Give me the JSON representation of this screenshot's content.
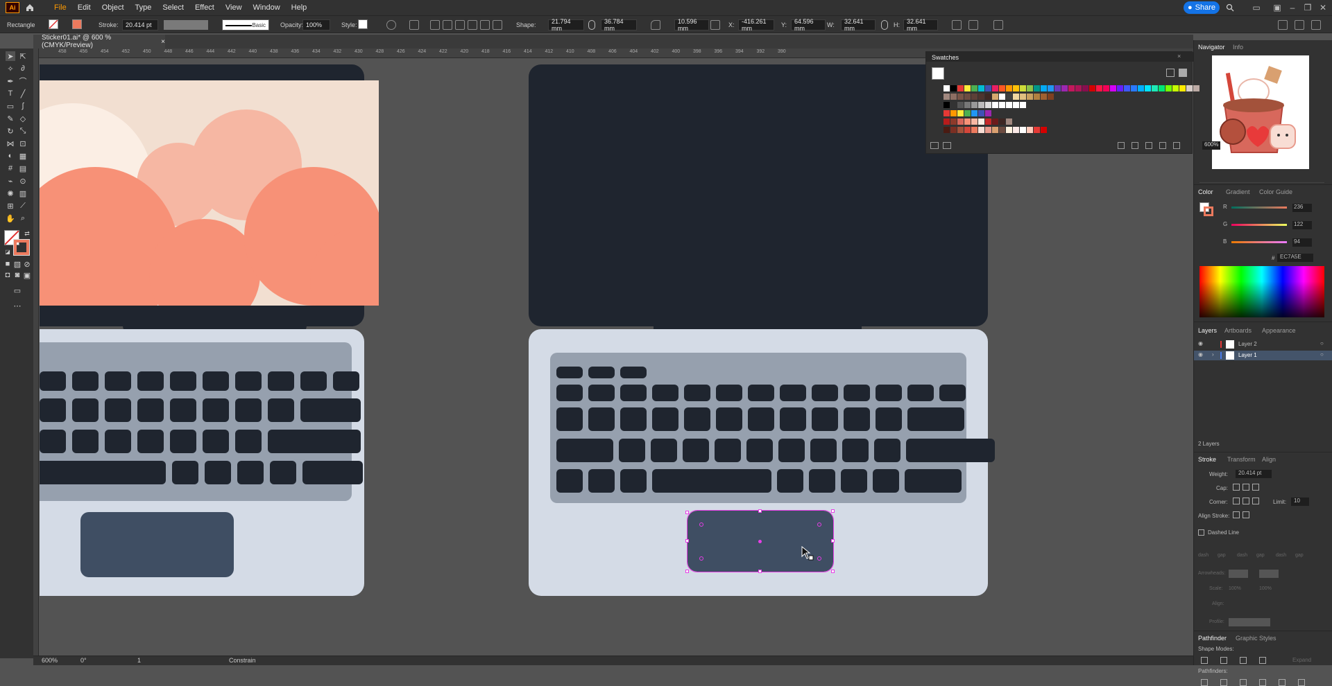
{
  "app": {
    "logo": "Ai",
    "title": "Adobe Illustrator"
  },
  "menu": [
    "File",
    "Edit",
    "Object",
    "Type",
    "Select",
    "Effect",
    "View",
    "Window",
    "Help"
  ],
  "share_label": "Share",
  "control_bar": {
    "selection_type": "Rectangle",
    "stroke_label": "Stroke:",
    "stroke_value": "20.414 pt",
    "brush_label": "Basic",
    "opacity_label": "Opacity:",
    "opacity_value": "100%",
    "style_label": "Style:",
    "shape_label": "Shape:",
    "width_value": "21.794 mm",
    "height_value": "36.784 mm",
    "corner_value": "10.596 mm",
    "x_label": "X:",
    "x_value": "-416.261 mm",
    "y_label": "Y:",
    "y_value": "64.596 mm",
    "w_label": "W:",
    "w_value": "32.641 mm",
    "h_label": "H:",
    "h_value": "32.641 mm"
  },
  "document_tab": {
    "title": "Sticker01.ai* @ 600 % (CMYK/Preview)",
    "close": "×"
  },
  "ruler_labels": [
    "458",
    "456",
    "454",
    "452",
    "450",
    "448",
    "446",
    "444",
    "442",
    "440",
    "438",
    "436",
    "434",
    "432",
    "430",
    "428",
    "426",
    "424",
    "422",
    "420",
    "418",
    "416",
    "414",
    "412",
    "410",
    "408",
    "406",
    "404",
    "402",
    "400",
    "398",
    "396",
    "394",
    "392",
    "390"
  ],
  "status": {
    "zoom": "600%",
    "angle": "0°",
    "artboard": "1",
    "mode": "Constrain"
  },
  "swatches_panel": {
    "title": "Swatches"
  },
  "navigator": {
    "tab1": "Navigator",
    "tab2": "Info",
    "zoom": "600%"
  },
  "color_panel": {
    "tabs": [
      "Color",
      "Gradient",
      "Color Guide"
    ],
    "r_label": "R",
    "r_value": "236",
    "g_label": "G",
    "g_value": "122",
    "b_label": "B",
    "b_value": "94",
    "hex": "EC7A5E"
  },
  "layers_panel": {
    "tabs": [
      "Layers",
      "Artboards",
      "Appearance"
    ],
    "layers": [
      {
        "name": "Layer 2"
      },
      {
        "name": "Layer 1"
      }
    ],
    "count": "2 Layers"
  },
  "stroke_panel": {
    "tabs": [
      "Stroke",
      "Transform",
      "Align"
    ],
    "weight_label": "Weight:",
    "weight_value": "20.414 pt",
    "cap_label": "Cap:",
    "corner_label": "Corner:",
    "limit_label": "Limit:",
    "limit_value": "10",
    "align_label": "Align Stroke:",
    "dashed_label": "Dashed Line",
    "dash_labels": [
      "dash",
      "gap",
      "dash",
      "gap",
      "dash",
      "gap"
    ],
    "arrowheads_label": "Arrowheads:",
    "scale_label": "Scale:",
    "scale_a": "100%",
    "scale_b": "100%",
    "align_arrow_label": "Align:",
    "profile_label": "Profile:"
  },
  "pathfinder_panel": {
    "tabs": [
      "Pathfinder",
      "Graphic Styles"
    ],
    "shape_modes_label": "Shape Modes:",
    "expand_label": "Expand",
    "pathfinders_label": "Pathfinders:"
  },
  "colors": {
    "accent_selection": "#e63ee6",
    "laptop_body": "#d4dbe6",
    "screen_bezel": "#1f252f",
    "keyboard_deck": "#96a0ae",
    "trackpad": "#3f4e63",
    "sky": "#f2dfd1",
    "cloud_front": "#f79177",
    "cloud_back": "#f6b7a3",
    "sun": "#fbeee4"
  }
}
